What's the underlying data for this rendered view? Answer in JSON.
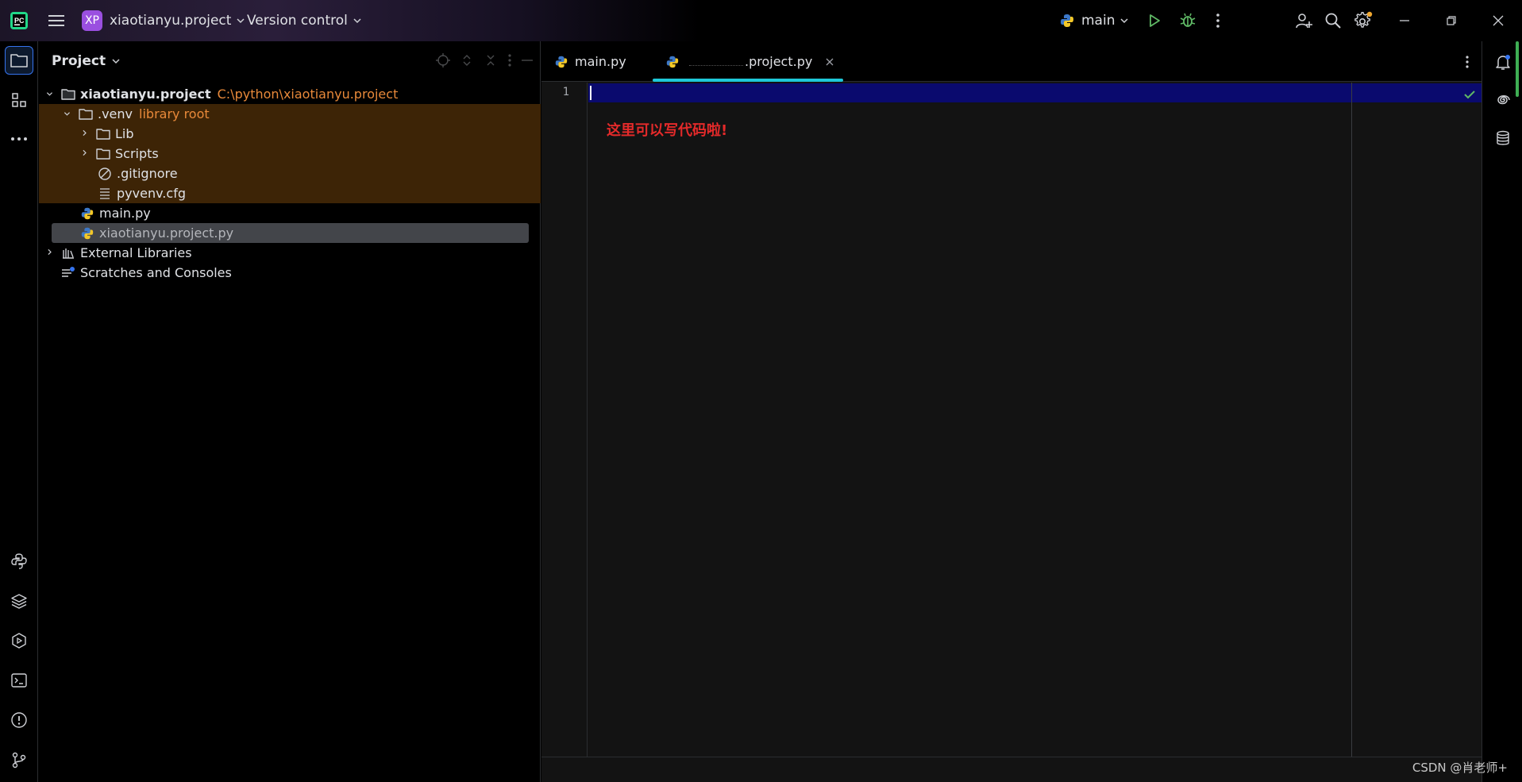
{
  "titlebar": {
    "project_badge": "XP",
    "project_name": "xiaotianyu.project",
    "version_control": "Version control",
    "run_config": "main"
  },
  "project_panel": {
    "title": "Project",
    "tree": {
      "root_name": "xiaotianyu.project",
      "root_path": "C:\\python\\xiaotianyu.project",
      "venv_name": ".venv",
      "venv_tag": "library root",
      "lib": "Lib",
      "scripts": "Scripts",
      "gitignore": ".gitignore",
      "pyvenv": "pyvenv.cfg",
      "main_py": "main.py",
      "project_py": "xiaotianyu.project.py",
      "external_libraries": "External Libraries",
      "scratches": "Scratches and Consoles"
    }
  },
  "editor": {
    "tabs": [
      {
        "label": "main.py"
      },
      {
        "label": ".project.py"
      }
    ],
    "line_number": "1",
    "annotation": "这里可以写代码啦!"
  },
  "watermark": "CSDN @肖老师+",
  "colors": {
    "accent_blue": "#3574f0",
    "tab_underline": "#1ec8d8",
    "venv_highlight": "#3d2406",
    "path_orange": "#e8893a",
    "annotation_red": "#e42a2a"
  }
}
